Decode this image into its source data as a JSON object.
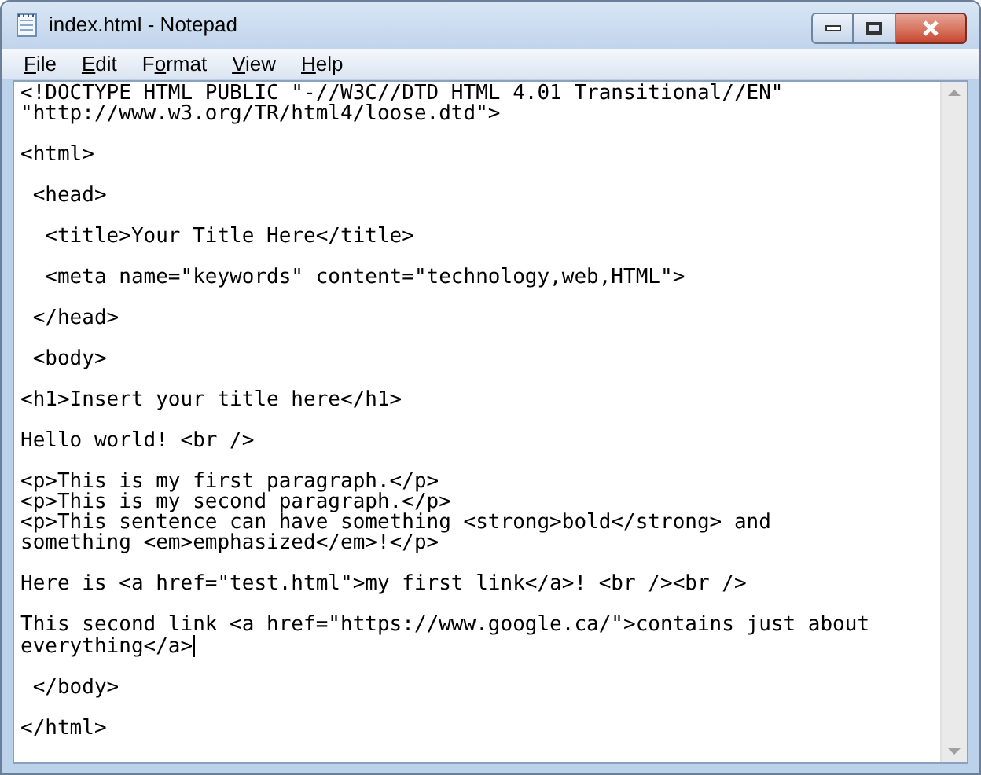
{
  "window": {
    "title": "index.html - Notepad"
  },
  "menu": [
    {
      "accel": "F",
      "after": "ile"
    },
    {
      "accel": "E",
      "after": "dit"
    },
    {
      "before": "F",
      "accel": "o",
      "after": "rmat"
    },
    {
      "accel": "V",
      "after": "iew"
    },
    {
      "accel": "H",
      "after": "elp"
    }
  ],
  "editor": {
    "blocks": [
      {
        "lines": [
          "<!DOCTYPE HTML PUBLIC \"-//W3C//DTD HTML 4.01 Transitional//EN\"",
          "\"http://www.w3.org/TR/html4/loose.dtd\">"
        ],
        "caret": false
      },
      {
        "lines": [
          "<html>"
        ],
        "caret": false
      },
      {
        "lines": [
          " <head>"
        ],
        "caret": false
      },
      {
        "lines": [
          "  <title>Your Title Here</title>"
        ],
        "caret": false
      },
      {
        "lines": [
          "  <meta name=\"keywords\" content=\"technology,web,HTML\">"
        ],
        "caret": false
      },
      {
        "lines": [
          " </head>"
        ],
        "caret": false
      },
      {
        "lines": [
          " <body>"
        ],
        "caret": false
      },
      {
        "lines": [
          "<h1>Insert your title here</h1>"
        ],
        "caret": false
      },
      {
        "lines": [
          "Hello world! <br />"
        ],
        "caret": false
      },
      {
        "lines": [
          "<p>This is my first paragraph.</p>",
          "<p>This is my second paragraph.</p>",
          "<p>This sentence can have something <strong>bold</strong> and",
          "something <em>emphasized</em>!</p>"
        ],
        "caret": false
      },
      {
        "lines": [
          "Here is <a href=\"test.html\">my first link</a>! <br /><br />"
        ],
        "caret": false
      },
      {
        "lines": [
          "This second link <a href=\"https://www.google.ca/\">contains just about",
          "everything</a>"
        ],
        "caret": true
      },
      {
        "lines": [
          " </body>"
        ],
        "caret": false
      },
      {
        "lines": [
          "</html>"
        ],
        "caret": false
      }
    ]
  }
}
